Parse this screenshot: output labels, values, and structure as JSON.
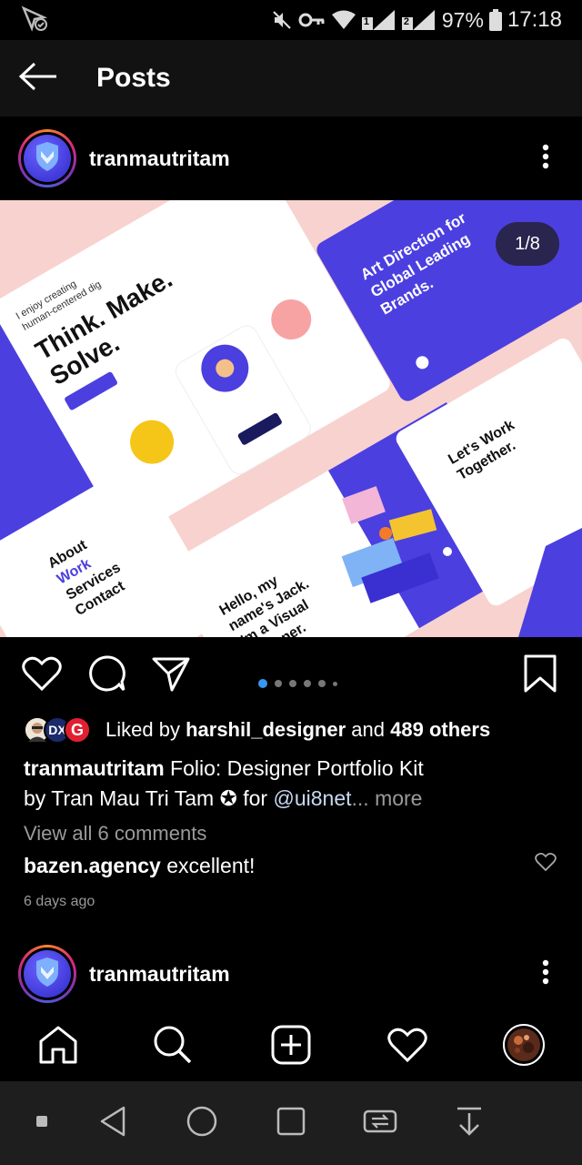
{
  "status_bar": {
    "battery": "97%",
    "time": "17:18",
    "sim1_label": "1",
    "sim2_label": "2"
  },
  "app_bar": {
    "title": "Posts"
  },
  "post": {
    "username": "tranmautritam",
    "counter": "1/8",
    "image_texts": {
      "tagline_1": "I enjoy creating",
      "tagline_2": "human-centered dig",
      "headline_1": "Think. Make.",
      "headline_2": "Solve.",
      "art_1": "Art Direction for",
      "art_2": "Global Leading",
      "art_3": "Brands.",
      "menu_about": "About",
      "menu_work": "Work",
      "menu_services": "Services",
      "menu_contact": "Contact",
      "hello_1": "Hello, my",
      "hello_2": "name's Jack.",
      "hello_3": "I'm a Visual",
      "hello_4": "Designer.",
      "together_1": "Let's Work",
      "together_2": "Together."
    },
    "likes": {
      "prefix": "Liked by",
      "user": "harshil_designer",
      "and": "and",
      "others": "489 others",
      "avatar_2_letters": "DX",
      "avatar_3_letter": "G"
    },
    "caption": {
      "username": "tranmautritam",
      "text_1": "Folio: Designer Portfolio Kit",
      "text_2": "by Tran Mau Tri Tam ✪ for",
      "mention": "@ui8net",
      "ellipsis": "...",
      "more": "more"
    },
    "view_comments": "View all 6 comments",
    "comment": {
      "username": "bazen.agency",
      "text": "excellent!"
    },
    "time_ago": "6 days ago"
  },
  "next_post": {
    "username": "tranmautritam"
  },
  "colors": {
    "accent_blue": "#3897f0",
    "brand_purple": "#4b3fe0",
    "background": "#000000"
  }
}
